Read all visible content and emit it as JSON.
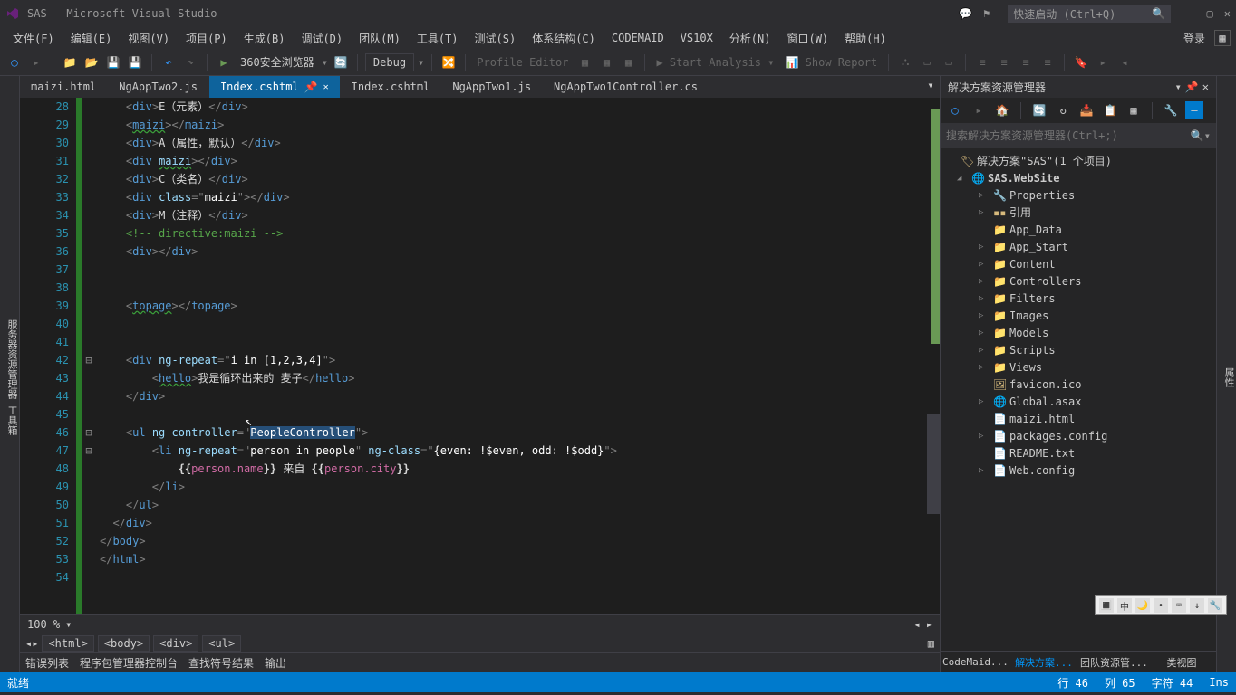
{
  "title": "SAS - Microsoft Visual Studio",
  "searchPlaceholder": "快速启动 (Ctrl+Q)",
  "menu": [
    "文件(F)",
    "编辑(E)",
    "视图(V)",
    "项目(P)",
    "生成(B)",
    "调试(D)",
    "团队(M)",
    "工具(T)",
    "测试(S)",
    "体系结构(C)",
    "CODEMAID",
    "VS10X",
    "分析(N)",
    "窗口(W)",
    "帮助(H)"
  ],
  "loginLabel": "登录",
  "toolbar": {
    "runTarget": "360安全浏览器",
    "config": "Debug",
    "profile": "Profile Editor",
    "startAnalysis": "Start Analysis",
    "showReport": "Show Report"
  },
  "leftStrip": "服务器资源管理器  工具箱",
  "rightStrip": "属性",
  "tabs": [
    {
      "label": "maizi.html",
      "active": false
    },
    {
      "label": "NgAppTwo2.js",
      "active": false
    },
    {
      "label": "Index.cshtml",
      "active": true,
      "pinned": true
    },
    {
      "label": "Index.cshtml",
      "active": false
    },
    {
      "label": "NgAppTwo1.js",
      "active": false
    },
    {
      "label": "NgAppTwo1Controller.cs",
      "active": false
    }
  ],
  "lineStart": 28,
  "lineEnd": 54,
  "zoom": "100 %",
  "breadcrumb": [
    "<html>",
    "<body>",
    "<div>",
    "<ul>"
  ],
  "bottomTabs": [
    "错误列表",
    "程序包管理器控制台",
    "查找符号结果",
    "输出"
  ],
  "status": {
    "ready": "就绪",
    "line": "行 46",
    "col": "列 65",
    "char": "字符 44",
    "ins": "Ins"
  },
  "solution": {
    "title": "解决方案资源管理器",
    "searchPlaceholder": "搜索解决方案资源管理器(Ctrl+;)",
    "root": "解决方案\"SAS\"(1 个项目)",
    "project": "SAS.WebSite",
    "nodes": [
      {
        "label": "Properties",
        "icon": "🔧",
        "indent": 2,
        "arrow": "▷"
      },
      {
        "label": "引用",
        "icon": "▪▪",
        "indent": 2,
        "arrow": "▷"
      },
      {
        "label": "App_Data",
        "icon": "📁",
        "indent": 2,
        "arrow": ""
      },
      {
        "label": "App_Start",
        "icon": "📁",
        "indent": 2,
        "arrow": "▷"
      },
      {
        "label": "Content",
        "icon": "📁",
        "indent": 2,
        "arrow": "▷"
      },
      {
        "label": "Controllers",
        "icon": "📁",
        "indent": 2,
        "arrow": "▷"
      },
      {
        "label": "Filters",
        "icon": "📁",
        "indent": 2,
        "arrow": "▷"
      },
      {
        "label": "Images",
        "icon": "📁",
        "indent": 2,
        "arrow": "▷"
      },
      {
        "label": "Models",
        "icon": "📁",
        "indent": 2,
        "arrow": "▷"
      },
      {
        "label": "Scripts",
        "icon": "📁",
        "indent": 2,
        "arrow": "▷"
      },
      {
        "label": "Views",
        "icon": "📁",
        "indent": 2,
        "arrow": "▷"
      },
      {
        "label": "favicon.ico",
        "icon": "🖼",
        "indent": 2,
        "arrow": ""
      },
      {
        "label": "Global.asax",
        "icon": "🌐",
        "indent": 2,
        "arrow": "▷"
      },
      {
        "label": "maizi.html",
        "icon": "📄",
        "indent": 2,
        "arrow": ""
      },
      {
        "label": "packages.config",
        "icon": "📄",
        "indent": 2,
        "arrow": "▷"
      },
      {
        "label": "README.txt",
        "icon": "📄",
        "indent": 2,
        "arrow": ""
      },
      {
        "label": "Web.config",
        "icon": "📄",
        "indent": 2,
        "arrow": "▷"
      }
    ],
    "bottomTabs": [
      "CodeMaid...",
      "解决方案...",
      "团队资源管...",
      "类视图"
    ]
  },
  "code": {
    "l28": {
      "txt": "E（元素）"
    },
    "l30": {
      "txt": "A（属性，默认）"
    },
    "l32": {
      "txt": "C（类名）"
    },
    "l34": {
      "txt": "M（注释）"
    },
    "l35": "<!-- directive:maizi -->",
    "l42_repeat": "i in [1,2,3,4]",
    "l43_txt": "我是循环出来的 麦子",
    "l46_ctrl": "PeopleController",
    "l47_repeat": "person in people",
    "l47_class": "{even: !$even, odd: !$odd}",
    "l48_txt": " 来自 ",
    "person_name": "person.name",
    "person_city": "person.city"
  }
}
